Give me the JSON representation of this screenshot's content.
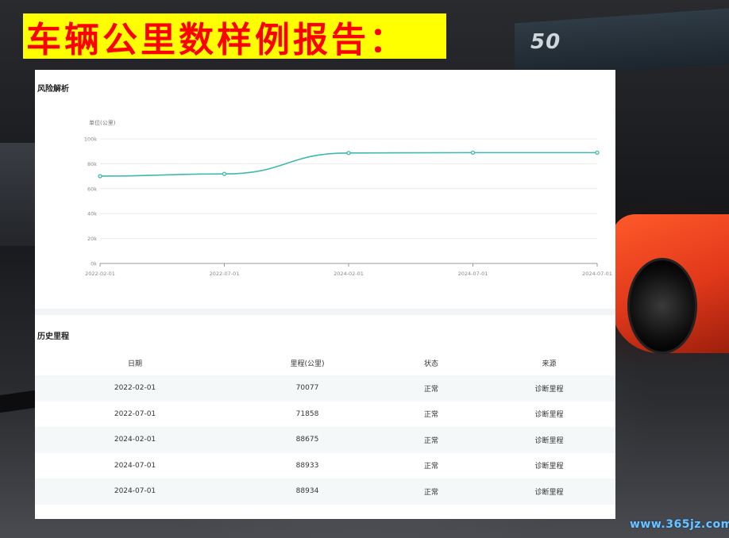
{
  "page": {
    "title": "车辆公里数样例报告："
  },
  "background": {
    "sign_text": "50"
  },
  "risk_section": {
    "title": "风险解析"
  },
  "chart_data": {
    "type": "line",
    "ylabel": "单位(公里)",
    "x": [
      "2022-02-01",
      "2022-07-01",
      "2024-02-01",
      "2024-07-01",
      "2024-07-01"
    ],
    "y_ticks": [
      "0k",
      "20k",
      "40k",
      "60k",
      "80k",
      "100k"
    ],
    "ylim": [
      0,
      100000
    ],
    "series": [
      {
        "values": [
          70077,
          71858,
          88675,
          88933,
          88934
        ],
        "color": "#3fb8af"
      }
    ],
    "grid": true,
    "smooth": true
  },
  "history_section": {
    "title": "历史里程",
    "columns": [
      "日期",
      "里程(公里)",
      "状态",
      "来源"
    ],
    "rows": [
      [
        "2022-02-01",
        "70077",
        "正常",
        "诊断里程"
      ],
      [
        "2022-07-01",
        "71858",
        "正常",
        "诊断里程"
      ],
      [
        "2024-02-01",
        "88675",
        "正常",
        "诊断里程"
      ],
      [
        "2024-07-01",
        "88933",
        "正常",
        "诊断里程"
      ],
      [
        "2024-07-01",
        "88934",
        "正常",
        "诊断里程"
      ]
    ]
  },
  "watermark": "www.365jz.com",
  "colors": {
    "banner_bg": "#ffff00",
    "banner_text": "#ff0000",
    "line": "#3fb8af"
  }
}
